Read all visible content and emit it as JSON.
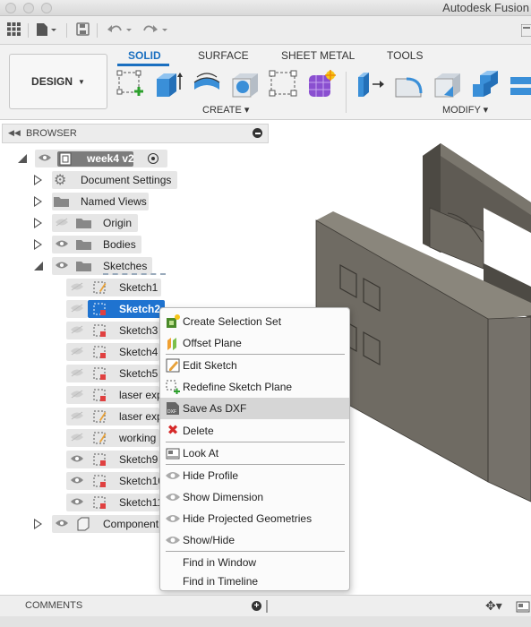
{
  "app": {
    "title": "Autodesk Fusion"
  },
  "ribbon": {
    "workspace": "DESIGN",
    "tabs": [
      "SOLID",
      "SURFACE",
      "SHEET METAL",
      "TOOLS"
    ],
    "groups": {
      "create": "CREATE",
      "modify": "MODIFY"
    }
  },
  "browser": {
    "title": "BROWSER",
    "root": "week4 v2",
    "folders": [
      "Document Settings",
      "Named Views",
      "Origin",
      "Bodies",
      "Sketches"
    ],
    "sketches": [
      "Sketch1",
      "Sketch2",
      "Sketch3",
      "Sketch4",
      "Sketch5",
      "laser exp",
      "laser exp",
      "working",
      "Sketch9",
      "Sketch10",
      "Sketch11"
    ],
    "components": "Component",
    "selected": "Sketch2"
  },
  "context_menu": {
    "items": [
      {
        "label": "Create Selection Set",
        "icon": "selection-set-icon"
      },
      {
        "label": "Offset Plane",
        "icon": "offset-plane-icon"
      },
      {
        "label": "Edit Sketch",
        "icon": "edit-sketch-icon"
      },
      {
        "label": "Redefine Sketch Plane",
        "icon": "redefine-plane-icon"
      },
      {
        "label": "Save As DXF",
        "icon": "dxf-icon"
      },
      {
        "label": "Delete",
        "icon": "delete-icon"
      },
      {
        "label": "Look At",
        "icon": "look-at-icon"
      },
      {
        "label": "Hide Profile",
        "icon": "eye-icon"
      },
      {
        "label": "Show Dimension",
        "icon": "eye-icon"
      },
      {
        "label": "Hide Projected Geometries",
        "icon": "eye-icon"
      },
      {
        "label": "Show/Hide",
        "icon": "eye-icon"
      },
      {
        "label": "Find in Window",
        "icon": ""
      },
      {
        "label": "Find in Timeline",
        "icon": ""
      }
    ],
    "highlighted": "Save As DXF"
  },
  "comments": {
    "title": "COMMENTS"
  },
  "colors": {
    "accent": "#1a6fc0",
    "selection": "#1f73d0",
    "model": "#6e6a62"
  }
}
